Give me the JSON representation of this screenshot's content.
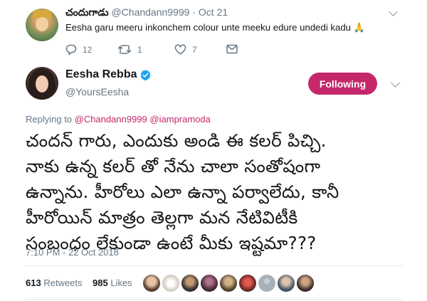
{
  "reply_tweet": {
    "author_name": "చందుగాడు",
    "handle": "@Chandann9999",
    "dot": "·",
    "date": "Oct 21",
    "text": "Eesha garu meeru inkonchem colour unte meeku edure undedi kadu",
    "emoji": "🙏",
    "actions": {
      "replies": "12",
      "retweets": "1",
      "likes": "7"
    }
  },
  "main_tweet": {
    "author_name": "Eesha Rebba",
    "handle": "@YoursEesha",
    "follow_label": "Following",
    "replying_prefix": "Replying to",
    "replying_to_1": "@Chandann9999",
    "replying_to_2": "@iampramoda",
    "body_lines": [
      "చందన్ గారు, ఎందుకు అండి ఈ కలర్ పిచ్చి.",
      "నాకు ఉన్న కలర్ తో నేను చాలా సంతోషంగా",
      "ఉన్నాను. హీరోలు ఎలా ఉన్నా పర్వాలేదు, కానీ",
      "హీరోయిన్ మాత్రం తెల్లగా మన నేటివిటీకి",
      "సంబంధం లేకుండా ఉంటే మీకు ఇష్టమా???"
    ],
    "timestamp": "7:10 PM - 22 Oct 2018",
    "retweets_count": "613",
    "retweets_label": "Retweets",
    "likes_count": "985",
    "likes_label": "Likes"
  },
  "colors": {
    "accent": "#c4286b",
    "muted": "#657786",
    "verified": "#1da1f2"
  },
  "icons": [
    "reply-icon",
    "retweet-icon",
    "heart-icon",
    "message-icon",
    "verified-badge-icon",
    "chevron-down-icon"
  ],
  "liker_avatars": 10
}
